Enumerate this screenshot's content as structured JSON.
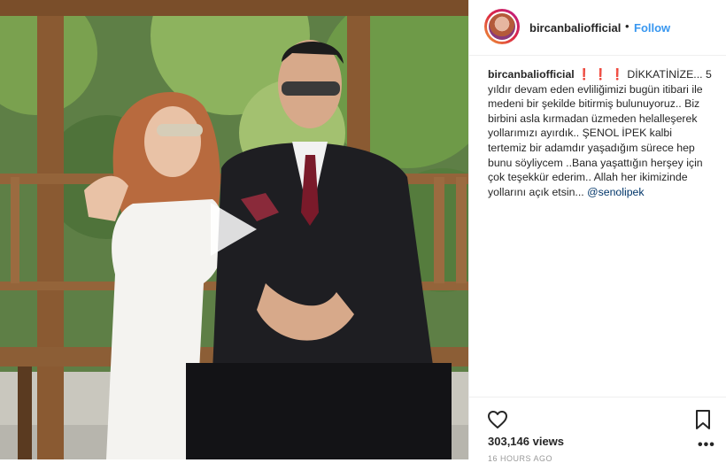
{
  "post": {
    "username": "bircanbaliofficial",
    "separator": "•",
    "follow_label": "Follow",
    "caption_user": "bircanbaliofficial",
    "caption_marks": "❗ ❗ ❗",
    "caption_text": "DİKKATİNİZE... 5 yıldır devam eden evliliğimizi bugün itibari ile medeni bir şekilde bitirmiş bulunuyoruz.. Biz birbini asla kırmadan üzmeden helalleşerek yollarımızı ayırdık.. ŞENOL İPEK kalbi tertemiz bir adamdır yaşadığım sürece hep bunu söyliycem ..Bana yaşattığın herşey için çok teşekkür ederim.. Allah her ikimizinde yollarını açık etsin...",
    "mention": "@senolipek",
    "views": "303,146 views",
    "timestamp": "16 HOURS AGO",
    "more_label": "•••"
  },
  "icons": {
    "play": "play-icon",
    "heart": "heart-icon",
    "bookmark": "bookmark-icon",
    "more": "more-options-icon"
  },
  "colors": {
    "link": "#3897f0",
    "text": "#262626",
    "muted": "#999999",
    "mention": "#003569",
    "alert": "#ed1c24"
  }
}
